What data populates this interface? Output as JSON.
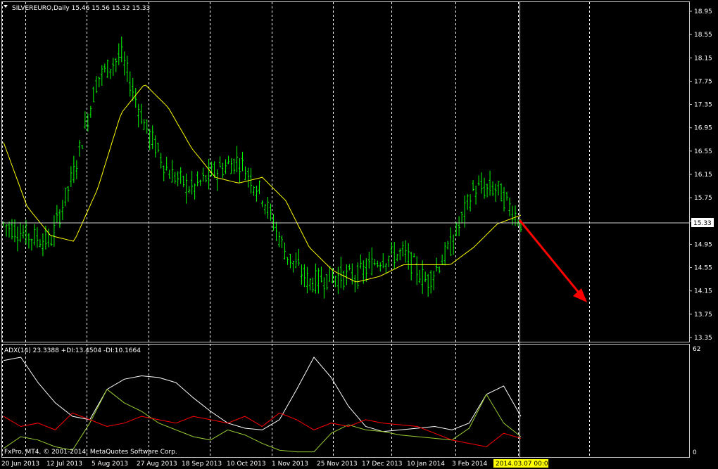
{
  "header": {
    "symbol_info": "SILVEREURO,Daily  15.46 15.56 15.32 15.33",
    "dropdown_icon": "triangle-down-icon"
  },
  "indicator": {
    "label": "ADX(14) 23.3388 +DI:13.4504 -DI:10.1664",
    "scale_top": "62",
    "scale_bottom": "0"
  },
  "copyright": "FxPro, MT4, © 2001-2014, MetaQuotes Software Corp.",
  "crosshair": {
    "price_label": "15.33",
    "time_label": "2014.03.07 00:00"
  },
  "colors": {
    "background": "#000000",
    "candles": "#00ff00",
    "moving_average": "#ffff00",
    "adx_line": "#ffffff",
    "plus_di": "#9acd32",
    "minus_di": "#ff0000",
    "arrow": "#ff0000",
    "grid": "#ffffff"
  },
  "chart_data": [
    {
      "type": "candlestick",
      "title": "SILVEREURO,Daily",
      "ohlc_last": {
        "open": 15.46,
        "high": 15.56,
        "low": 15.32,
        "close": 15.33
      },
      "y_ticks": [
        "18.95",
        "18.55",
        "18.15",
        "17.75",
        "17.35",
        "16.95",
        "16.55",
        "16.15",
        "15.75",
        "15.35",
        "14.95",
        "14.55",
        "14.15",
        "13.75",
        "13.35"
      ],
      "ylim": [
        13.35,
        18.95
      ],
      "x_ticks": [
        "20 Jun 2013",
        "12 Jul 2013",
        "5 Aug 2013",
        "27 Aug 2013",
        "18 Sep 2013",
        "10 Oct 2013",
        "1 Nov 2013",
        "25 Nov 2013",
        "17 Dec 2013",
        "10 Jan 2014",
        "3 Feb 2014"
      ],
      "series": [
        {
          "name": "close",
          "points": [
            [
              "20 Jun 2013",
              15.3
            ],
            [
              "12 Jul 2013",
              15.1
            ],
            [
              "5 Aug 2013",
              15.0
            ],
            [
              "10 Aug 2013",
              16.2
            ],
            [
              "20 Aug 2013",
              17.8
            ],
            [
              "27 Aug 2013",
              18.2
            ],
            [
              "5 Sep 2013",
              17.0
            ],
            [
              "18 Sep 2013",
              16.2
            ],
            [
              "1 Oct 2013",
              15.9
            ],
            [
              "10 Oct 2013",
              16.2
            ],
            [
              "20 Oct 2013",
              16.4
            ],
            [
              "1 Nov 2013",
              15.8
            ],
            [
              "12 Nov 2013",
              14.8
            ],
            [
              "25 Nov 2013",
              14.3
            ],
            [
              "5 Dec 2013",
              14.4
            ],
            [
              "17 Dec 2013",
              14.4
            ],
            [
              "28 Dec 2013",
              14.7
            ],
            [
              "10 Jan 2014",
              14.8
            ],
            [
              "22 Jan 2014",
              14.3
            ],
            [
              "3 Feb 2014",
              14.9
            ],
            [
              "14 Feb 2014",
              15.9
            ],
            [
              "25 Feb 2014",
              15.9
            ],
            [
              "7 Mar 2014",
              15.33
            ]
          ]
        },
        {
          "name": "moving average",
          "points": [
            [
              "20 Jun 2013",
              16.7
            ],
            [
              "1 Jul 2013",
              15.6
            ],
            [
              "12 Jul 2013",
              15.1
            ],
            [
              "5 Aug 2013",
              15.0
            ],
            [
              "15 Aug 2013",
              15.9
            ],
            [
              "27 Aug 2013",
              17.2
            ],
            [
              "5 Sep 2013",
              17.7
            ],
            [
              "18 Sep 2013",
              17.3
            ],
            [
              "1 Oct 2013",
              16.6
            ],
            [
              "10 Oct 2013",
              16.1
            ],
            [
              "20 Oct 2013",
              16.0
            ],
            [
              "1 Nov 2013",
              16.1
            ],
            [
              "12 Nov 2013",
              15.7
            ],
            [
              "25 Nov 2013",
              14.9
            ],
            [
              "5 Dec 2013",
              14.5
            ],
            [
              "17 Dec 2013",
              14.3
            ],
            [
              "28 Dec 2013",
              14.4
            ],
            [
              "10 Jan 2014",
              14.6
            ],
            [
              "22 Jan 2014",
              14.6
            ],
            [
              "3 Feb 2014",
              14.6
            ],
            [
              "14 Feb 2014",
              14.9
            ],
            [
              "25 Feb 2014",
              15.3
            ],
            [
              "7 Mar 2014",
              15.45
            ]
          ]
        }
      ],
      "annotation": "red arrow pointing down-right (bearish projection)"
    },
    {
      "type": "line",
      "title": "ADX(14) 23.3388 +DI:13.4504 -DI:10.1664",
      "ylim": [
        0,
        62
      ],
      "series": [
        {
          "name": "ADX",
          "color": "#ffffff",
          "values": [
            55,
            57,
            42,
            30,
            22,
            20,
            38,
            44,
            46,
            45,
            42,
            33,
            25,
            18,
            15,
            14,
            20,
            38,
            57,
            45,
            28,
            16,
            13,
            14,
            15,
            16,
            14,
            18,
            35,
            40,
            22
          ]
        },
        {
          "name": "+DI",
          "color": "#9acd32",
          "values": [
            3,
            10,
            8,
            4,
            2,
            18,
            38,
            30,
            25,
            18,
            14,
            10,
            8,
            14,
            11,
            6,
            2,
            1,
            1,
            12,
            17,
            14,
            13,
            11,
            10,
            9,
            8,
            15,
            35,
            18,
            10
          ]
        },
        {
          "name": "-DI",
          "color": "#ff0000",
          "values": [
            22,
            16,
            18,
            14,
            24,
            20,
            16,
            18,
            22,
            20,
            18,
            22,
            20,
            18,
            22,
            16,
            24,
            20,
            14,
            18,
            16,
            20,
            18,
            17,
            16,
            12,
            8,
            6,
            4,
            12,
            9
          ]
        }
      ]
    }
  ]
}
